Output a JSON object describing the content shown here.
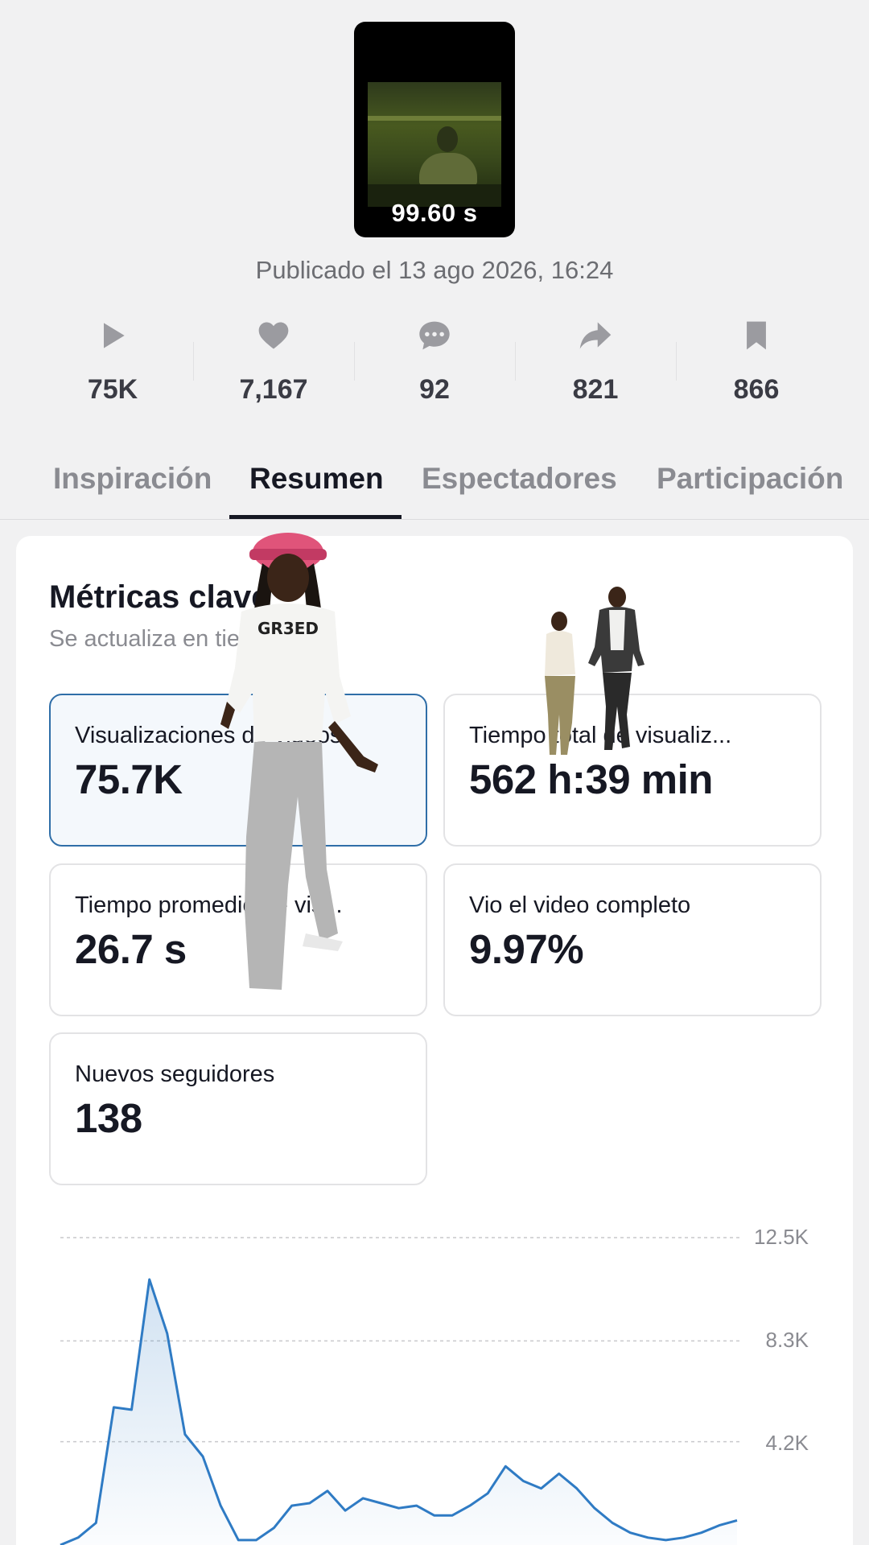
{
  "video": {
    "duration": "99.60 s",
    "published": "Publicado el 13 ago 2026, 16:24"
  },
  "stats": [
    {
      "icon": "play-icon",
      "value": "75K"
    },
    {
      "icon": "heart-icon",
      "value": "7,167"
    },
    {
      "icon": "comment-icon",
      "value": "92"
    },
    {
      "icon": "share-icon",
      "value": "821"
    },
    {
      "icon": "bookmark-icon",
      "value": "866"
    }
  ],
  "tabs": [
    {
      "label": "Inspiración",
      "active": false
    },
    {
      "label": "Resumen",
      "active": true
    },
    {
      "label": "Espectadores",
      "active": false
    },
    {
      "label": "Participación",
      "active": false
    }
  ],
  "metrics_card": {
    "title": "Métricas clave",
    "subtitle": "Se actualiza en tiempo real.",
    "metrics": [
      {
        "label": "Visualizaciones de videos",
        "value": "75.7K",
        "selected": true
      },
      {
        "label": "Tiempo total de visualiz...",
        "value": "562 h:39 min",
        "selected": false
      },
      {
        "label": "Tiempo promedio de vis...",
        "value": "26.7 s",
        "selected": false
      },
      {
        "label": "Vio el video completo",
        "value": "9.97%",
        "selected": false
      },
      {
        "label": "Nuevos seguidores",
        "value": "138",
        "selected": false
      }
    ]
  },
  "chart_data": {
    "type": "area",
    "y_ticks": [
      "12.5K",
      "8.3K",
      "4.2K"
    ],
    "ylim": [
      0,
      12500
    ],
    "grid": true,
    "color": "#2f7bc4",
    "values": [
      0,
      300,
      900,
      5600,
      5500,
      10800,
      8600,
      4500,
      3600,
      1600,
      200,
      200,
      700,
      1600,
      1700,
      2200,
      1400,
      1900,
      1700,
      1500,
      1600,
      1200,
      1200,
      1600,
      2100,
      3200,
      2600,
      2300,
      2900,
      2300,
      1500,
      900,
      500,
      300,
      200,
      300,
      500,
      800,
      1000
    ]
  }
}
